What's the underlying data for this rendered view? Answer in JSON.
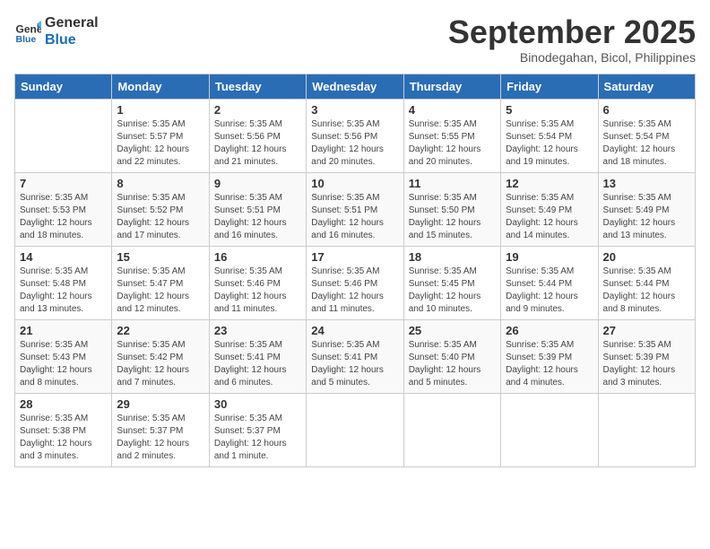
{
  "header": {
    "logo_line1": "General",
    "logo_line2": "Blue",
    "month": "September 2025",
    "location": "Binodegahan, Bicol, Philippines"
  },
  "days_of_week": [
    "Sunday",
    "Monday",
    "Tuesday",
    "Wednesday",
    "Thursday",
    "Friday",
    "Saturday"
  ],
  "weeks": [
    [
      {
        "day": "",
        "text": ""
      },
      {
        "day": "1",
        "text": "Sunrise: 5:35 AM\nSunset: 5:57 PM\nDaylight: 12 hours\nand 22 minutes."
      },
      {
        "day": "2",
        "text": "Sunrise: 5:35 AM\nSunset: 5:56 PM\nDaylight: 12 hours\nand 21 minutes."
      },
      {
        "day": "3",
        "text": "Sunrise: 5:35 AM\nSunset: 5:56 PM\nDaylight: 12 hours\nand 20 minutes."
      },
      {
        "day": "4",
        "text": "Sunrise: 5:35 AM\nSunset: 5:55 PM\nDaylight: 12 hours\nand 20 minutes."
      },
      {
        "day": "5",
        "text": "Sunrise: 5:35 AM\nSunset: 5:54 PM\nDaylight: 12 hours\nand 19 minutes."
      },
      {
        "day": "6",
        "text": "Sunrise: 5:35 AM\nSunset: 5:54 PM\nDaylight: 12 hours\nand 18 minutes."
      }
    ],
    [
      {
        "day": "7",
        "text": "Sunrise: 5:35 AM\nSunset: 5:53 PM\nDaylight: 12 hours\nand 18 minutes."
      },
      {
        "day": "8",
        "text": "Sunrise: 5:35 AM\nSunset: 5:52 PM\nDaylight: 12 hours\nand 17 minutes."
      },
      {
        "day": "9",
        "text": "Sunrise: 5:35 AM\nSunset: 5:51 PM\nDaylight: 12 hours\nand 16 minutes."
      },
      {
        "day": "10",
        "text": "Sunrise: 5:35 AM\nSunset: 5:51 PM\nDaylight: 12 hours\nand 16 minutes."
      },
      {
        "day": "11",
        "text": "Sunrise: 5:35 AM\nSunset: 5:50 PM\nDaylight: 12 hours\nand 15 minutes."
      },
      {
        "day": "12",
        "text": "Sunrise: 5:35 AM\nSunset: 5:49 PM\nDaylight: 12 hours\nand 14 minutes."
      },
      {
        "day": "13",
        "text": "Sunrise: 5:35 AM\nSunset: 5:49 PM\nDaylight: 12 hours\nand 13 minutes."
      }
    ],
    [
      {
        "day": "14",
        "text": "Sunrise: 5:35 AM\nSunset: 5:48 PM\nDaylight: 12 hours\nand 13 minutes."
      },
      {
        "day": "15",
        "text": "Sunrise: 5:35 AM\nSunset: 5:47 PM\nDaylight: 12 hours\nand 12 minutes."
      },
      {
        "day": "16",
        "text": "Sunrise: 5:35 AM\nSunset: 5:46 PM\nDaylight: 12 hours\nand 11 minutes."
      },
      {
        "day": "17",
        "text": "Sunrise: 5:35 AM\nSunset: 5:46 PM\nDaylight: 12 hours\nand 11 minutes."
      },
      {
        "day": "18",
        "text": "Sunrise: 5:35 AM\nSunset: 5:45 PM\nDaylight: 12 hours\nand 10 minutes."
      },
      {
        "day": "19",
        "text": "Sunrise: 5:35 AM\nSunset: 5:44 PM\nDaylight: 12 hours\nand 9 minutes."
      },
      {
        "day": "20",
        "text": "Sunrise: 5:35 AM\nSunset: 5:44 PM\nDaylight: 12 hours\nand 8 minutes."
      }
    ],
    [
      {
        "day": "21",
        "text": "Sunrise: 5:35 AM\nSunset: 5:43 PM\nDaylight: 12 hours\nand 8 minutes."
      },
      {
        "day": "22",
        "text": "Sunrise: 5:35 AM\nSunset: 5:42 PM\nDaylight: 12 hours\nand 7 minutes."
      },
      {
        "day": "23",
        "text": "Sunrise: 5:35 AM\nSunset: 5:41 PM\nDaylight: 12 hours\nand 6 minutes."
      },
      {
        "day": "24",
        "text": "Sunrise: 5:35 AM\nSunset: 5:41 PM\nDaylight: 12 hours\nand 5 minutes."
      },
      {
        "day": "25",
        "text": "Sunrise: 5:35 AM\nSunset: 5:40 PM\nDaylight: 12 hours\nand 5 minutes."
      },
      {
        "day": "26",
        "text": "Sunrise: 5:35 AM\nSunset: 5:39 PM\nDaylight: 12 hours\nand 4 minutes."
      },
      {
        "day": "27",
        "text": "Sunrise: 5:35 AM\nSunset: 5:39 PM\nDaylight: 12 hours\nand 3 minutes."
      }
    ],
    [
      {
        "day": "28",
        "text": "Sunrise: 5:35 AM\nSunset: 5:38 PM\nDaylight: 12 hours\nand 3 minutes."
      },
      {
        "day": "29",
        "text": "Sunrise: 5:35 AM\nSunset: 5:37 PM\nDaylight: 12 hours\nand 2 minutes."
      },
      {
        "day": "30",
        "text": "Sunrise: 5:35 AM\nSunset: 5:37 PM\nDaylight: 12 hours\nand 1 minute."
      },
      {
        "day": "",
        "text": ""
      },
      {
        "day": "",
        "text": ""
      },
      {
        "day": "",
        "text": ""
      },
      {
        "day": "",
        "text": ""
      }
    ]
  ]
}
